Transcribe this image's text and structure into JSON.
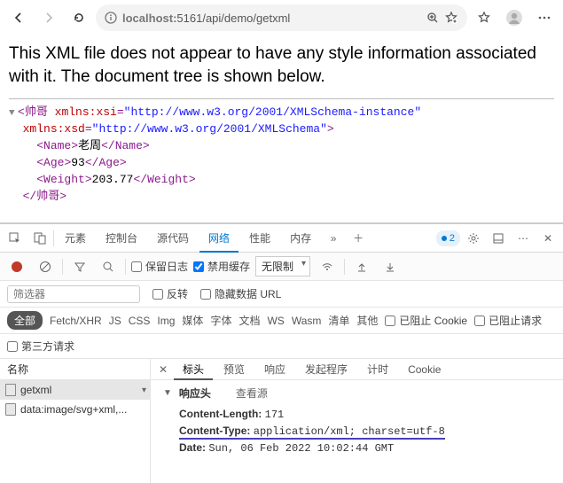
{
  "address": {
    "prefix_host": "localhost:",
    "port_path": "5161/api/demo/getxml"
  },
  "page": {
    "message": "This XML file does not appear to have any style information associated with it. The document tree is shown below.",
    "xml": {
      "root": "帅哥",
      "ns1_attr": "xmlns:xsi",
      "ns1_val": "\"http://www.w3.org/2001/XMLSchema-instance\"",
      "ns2_attr": "xmlns:xsd",
      "ns2_val": "\"http://www.w3.org/2001/XMLSchema\"",
      "name_tag": "Name",
      "name_val": "老周",
      "age_tag": "Age",
      "age_val": "93",
      "weight_tag": "Weight",
      "weight_val": "203.77"
    }
  },
  "devtools": {
    "tabs": {
      "elements": "元素",
      "console": "控制台",
      "sources": "源代码",
      "network": "网络",
      "performance": "性能",
      "memory": "内存"
    },
    "badge": "2",
    "row2": {
      "preserve": "保留日志",
      "disable_cache": "禁用缓存",
      "throttle": "无限制"
    },
    "row3": {
      "filter_placeholder": "筛选器",
      "invert": "反转",
      "hide_data": "隐藏数据 URL"
    },
    "row4": {
      "all": "全部",
      "types": [
        "Fetch/XHR",
        "JS",
        "CSS",
        "Img",
        "媒体",
        "字体",
        "文档",
        "WS",
        "Wasm",
        "清单",
        "其他"
      ],
      "blocked_cookie": "已阻止 Cookie",
      "blocked_req": "已阻止请求"
    },
    "row5": {
      "third_party": "第三方请求"
    },
    "name_col": "名称",
    "requests": [
      "getxml",
      "data:image/svg+xml,..."
    ],
    "detail_tabs": {
      "headers": "标头",
      "preview": "预览",
      "response": "响应",
      "initiator": "发起程序",
      "timing": "计时",
      "cookies": "Cookie"
    },
    "response_headers": {
      "title": "响应头",
      "view_source": "查看源"
    },
    "headers": {
      "cl_k": "Content-Length:",
      "cl_v": "171",
      "ct_k": "Content-Type:",
      "ct_v": "application/xml; charset=utf-8",
      "dt_k": "Date:",
      "dt_v": "Sun, 06 Feb 2022 10:02:44 GMT"
    }
  }
}
